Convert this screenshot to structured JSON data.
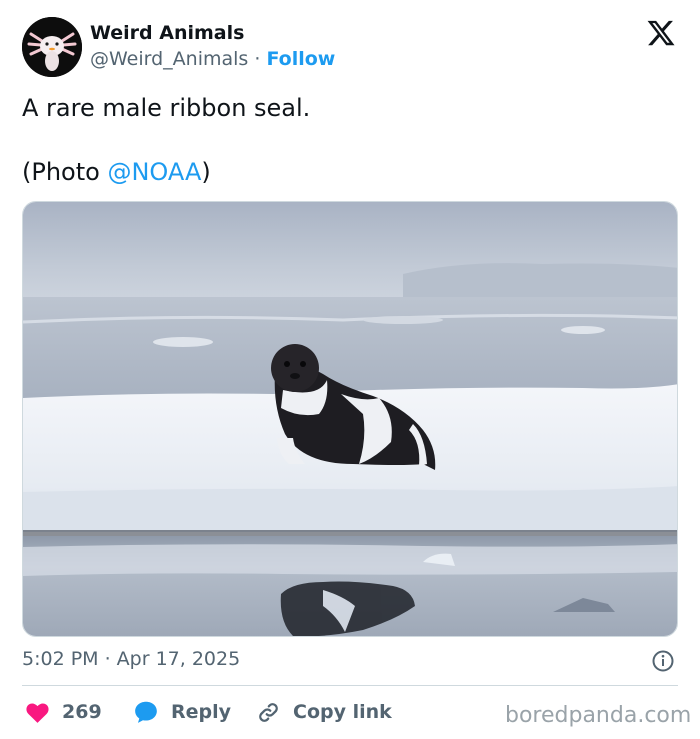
{
  "account": {
    "display_name": "Weird Animals",
    "handle": "@Weird_Animals",
    "separator": " · ",
    "follow_label": "Follow"
  },
  "tweet": {
    "line1": "A rare male ribbon seal.",
    "photo_prefix": "(Photo ",
    "mention": "@NOAA",
    "photo_suffix": ")",
    "timestamp": "5:02 PM · Apr 17, 2025"
  },
  "actions": {
    "like_count": "269",
    "reply_label": "Reply",
    "copy_label": "Copy link"
  },
  "icons": {
    "platform": "x-logo-icon",
    "avatar": "axolotl-avatar",
    "info": "info-icon",
    "like": "heart-icon",
    "reply": "speech-bubble-icon",
    "copy": "link-icon"
  },
  "colors": {
    "accent": "#1d9bf0",
    "like": "#f91880",
    "text": "#0f1419",
    "muted": "#536471"
  },
  "watermark": "boredpanda.com"
}
